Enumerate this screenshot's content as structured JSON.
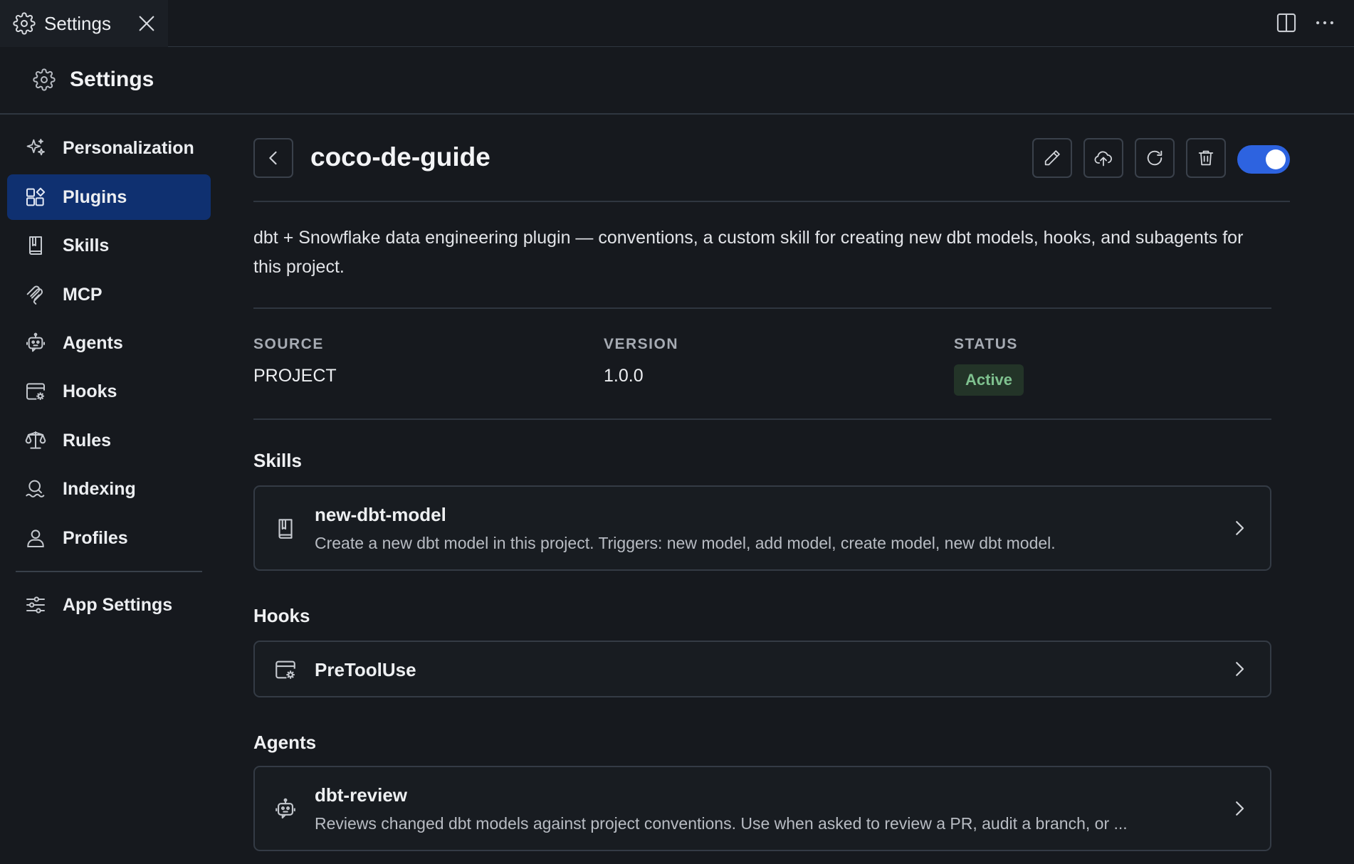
{
  "tab": {
    "title": "Settings"
  },
  "header": {
    "title": "Settings"
  },
  "sidebar": {
    "items": [
      {
        "label": "Personalization",
        "icon": "sparkles-icon"
      },
      {
        "label": "Plugins",
        "icon": "plugins-icon",
        "active": true
      },
      {
        "label": "Skills",
        "icon": "book-icon"
      },
      {
        "label": "MCP",
        "icon": "mcp-icon"
      },
      {
        "label": "Agents",
        "icon": "robot-icon"
      },
      {
        "label": "Hooks",
        "icon": "hook-window-icon"
      },
      {
        "label": "Rules",
        "icon": "scales-icon"
      },
      {
        "label": "Indexing",
        "icon": "indexing-icon"
      },
      {
        "label": "Profiles",
        "icon": "user-icon"
      }
    ],
    "app_settings": {
      "label": "App Settings",
      "icon": "sliders-icon"
    }
  },
  "plugin": {
    "name": "coco-de-guide",
    "description": "dbt + Snowflake data engineering plugin — conventions, a custom skill for creating new dbt models, hooks, and subagents for this project.",
    "enabled": true,
    "meta": {
      "source_label": "SOURCE",
      "source_value": "PROJECT",
      "version_label": "VERSION",
      "version_value": "1.0.0",
      "status_label": "STATUS",
      "status_value": "Active"
    }
  },
  "sections": {
    "skills": {
      "title": "Skills",
      "items": [
        {
          "name": "new-dbt-model",
          "description": "Create a new dbt model in this project. Triggers: new model, add model, create model, new dbt model."
        }
      ]
    },
    "hooks": {
      "title": "Hooks",
      "items": [
        {
          "name": "PreToolUse"
        }
      ]
    },
    "agents": {
      "title": "Agents",
      "items": [
        {
          "name": "dbt-review",
          "description": "Reviews changed dbt models against project conventions. Use when asked to review a PR, audit a branch, or ..."
        }
      ]
    }
  },
  "colors": {
    "background": "#16191e",
    "active_nav": "#0f3070",
    "toggle_on": "#2d63e0",
    "badge_bg": "#233428",
    "badge_text": "#7fc18f"
  }
}
